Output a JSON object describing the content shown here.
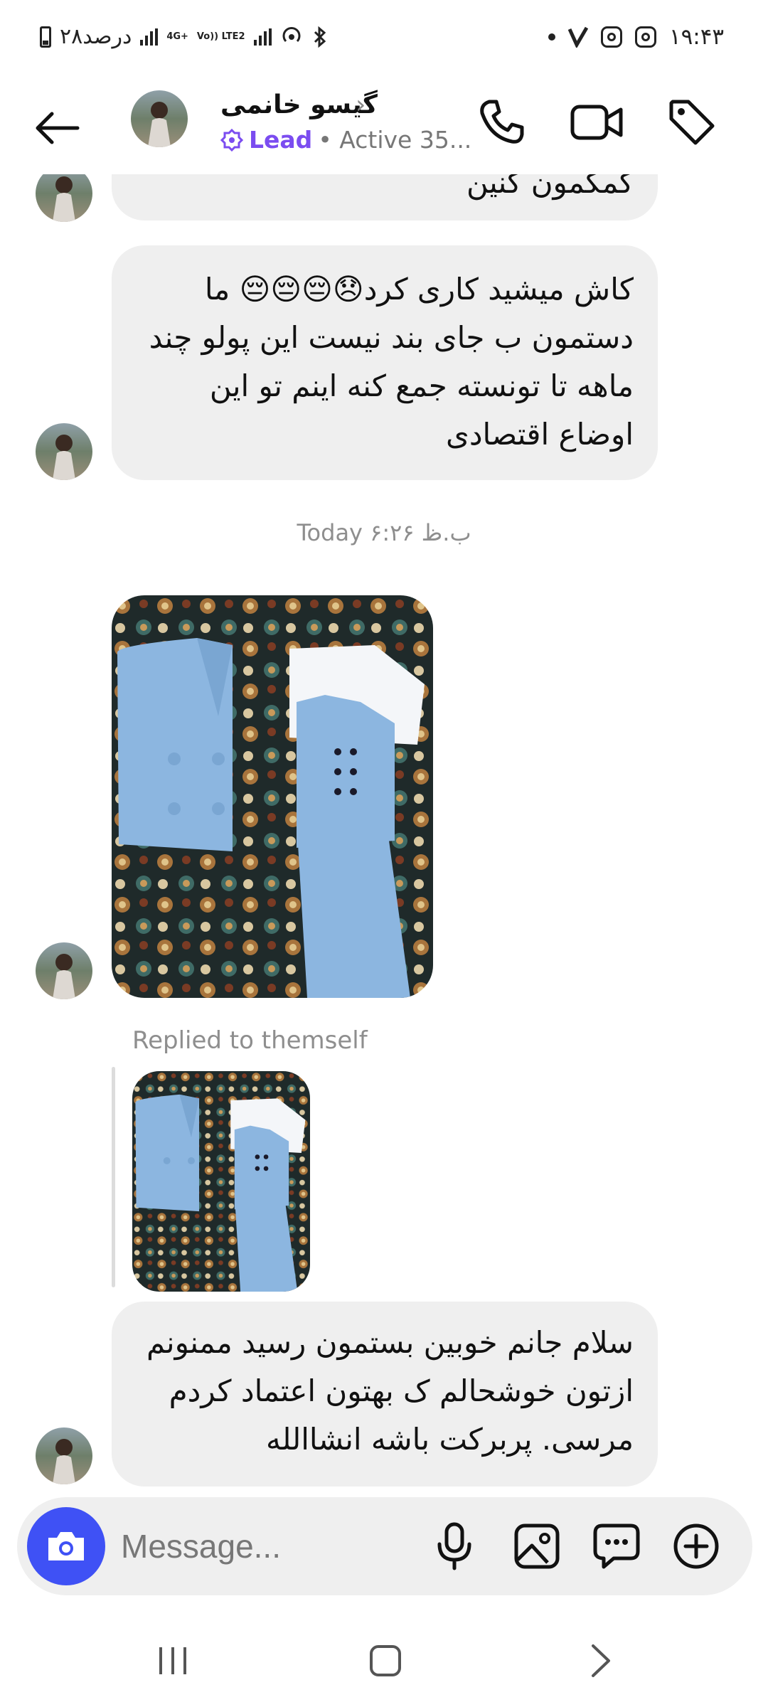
{
  "status_bar": {
    "battery_text": "۲۸درصد",
    "network_top": "4G+",
    "network_volte": "Vo)) LTE2",
    "time": "۱۹:۴۳"
  },
  "header": {
    "contact_name": "گیسو خانمی",
    "lead_label": "Lead",
    "active_status": "• Active 35..."
  },
  "messages": {
    "partial_text": "کمکمون کنین",
    "message_1": "کاش میشید کاری کرد😞😔😔😔 ما دستمون ب جای بند نیست این پولو چند ماهه تا تونسته جمع کنه اینم تو این اوضاع اقتصادی",
    "timestamp": "Today ب.ظ ۶:۲۶",
    "reply_label": "Replied to themself",
    "message_2": "سلام جانم خوبین بستمون رسید ممنونم ازتون خوشحالم ک بهتون اعتماد کردم مرسی. پربرکت باشه انشاالله"
  },
  "composer": {
    "placeholder": "Message..."
  },
  "icons": {
    "back": "arrow-left-icon",
    "call": "phone-icon",
    "video": "video-camera-icon",
    "tag": "tag-icon",
    "camera": "camera-icon",
    "mic": "microphone-icon",
    "gallery": "image-icon",
    "sticker": "chat-bubble-icon",
    "plus": "plus-circle-icon"
  },
  "colors": {
    "accent_blue": "#3f51f5",
    "lead_purple": "#7b4cf0",
    "bubble_grey": "#efefef",
    "muted_text": "#8e8e8e"
  }
}
